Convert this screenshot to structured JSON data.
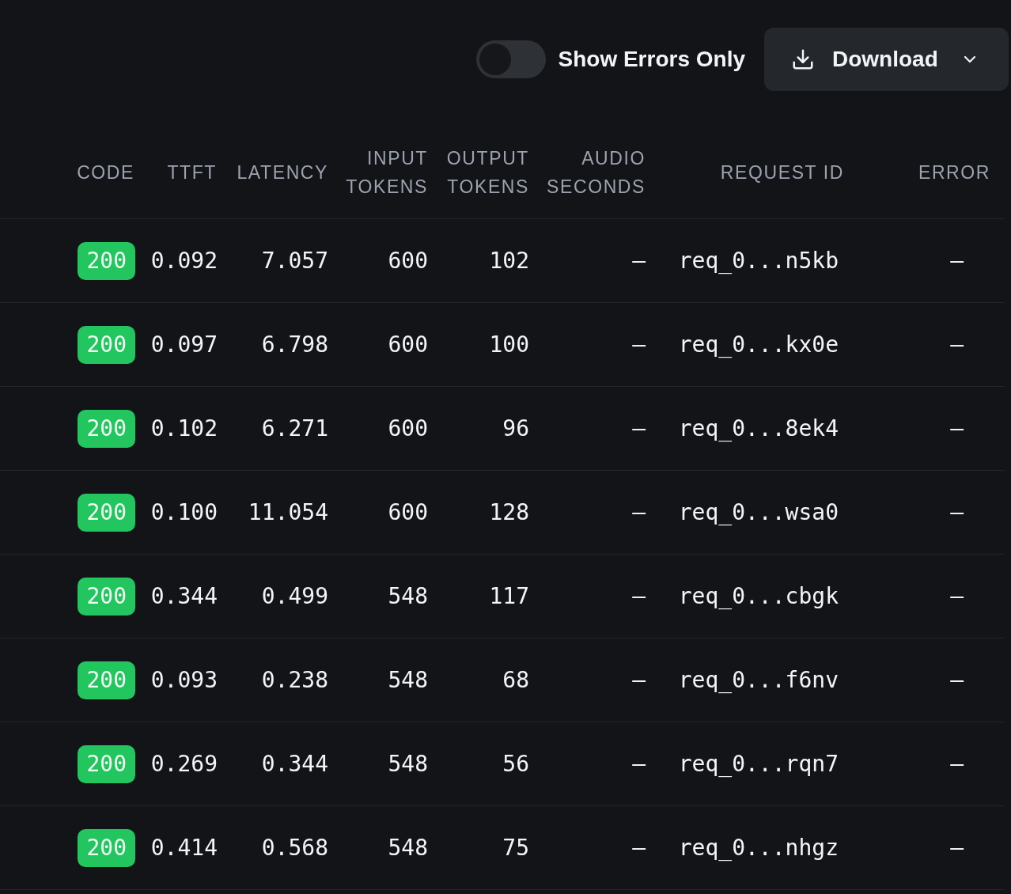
{
  "toolbar": {
    "toggle": {
      "label": "Show Errors Only",
      "on": false
    },
    "download": {
      "label": "Download"
    }
  },
  "table": {
    "columns": [
      "CODE",
      "TTFT",
      "LATENCY",
      "INPUT TOKENS",
      "OUTPUT TOKENS",
      "AUDIO SECONDS",
      "REQUEST ID",
      "ERROR"
    ],
    "rows": [
      {
        "code": "200",
        "ttft": "0.092",
        "latency": "7.057",
        "input": "600",
        "output": "102",
        "audio": "–",
        "request_id": "req_0...n5kb",
        "error": "–"
      },
      {
        "code": "200",
        "ttft": "0.097",
        "latency": "6.798",
        "input": "600",
        "output": "100",
        "audio": "–",
        "request_id": "req_0...kx0e",
        "error": "–"
      },
      {
        "code": "200",
        "ttft": "0.102",
        "latency": "6.271",
        "input": "600",
        "output": "96",
        "audio": "–",
        "request_id": "req_0...8ek4",
        "error": "–"
      },
      {
        "code": "200",
        "ttft": "0.100",
        "latency": "11.054",
        "input": "600",
        "output": "128",
        "audio": "–",
        "request_id": "req_0...wsa0",
        "error": "–"
      },
      {
        "code": "200",
        "ttft": "0.344",
        "latency": "0.499",
        "input": "548",
        "output": "117",
        "audio": "–",
        "request_id": "req_0...cbgk",
        "error": "–"
      },
      {
        "code": "200",
        "ttft": "0.093",
        "latency": "0.238",
        "input": "548",
        "output": "68",
        "audio": "–",
        "request_id": "req_0...f6nv",
        "error": "–"
      },
      {
        "code": "200",
        "ttft": "0.269",
        "latency": "0.344",
        "input": "548",
        "output": "56",
        "audio": "–",
        "request_id": "req_0...rqn7",
        "error": "–"
      },
      {
        "code": "200",
        "ttft": "0.414",
        "latency": "0.568",
        "input": "548",
        "output": "75",
        "audio": "–",
        "request_id": "req_0...nhgz",
        "error": "–"
      }
    ]
  }
}
